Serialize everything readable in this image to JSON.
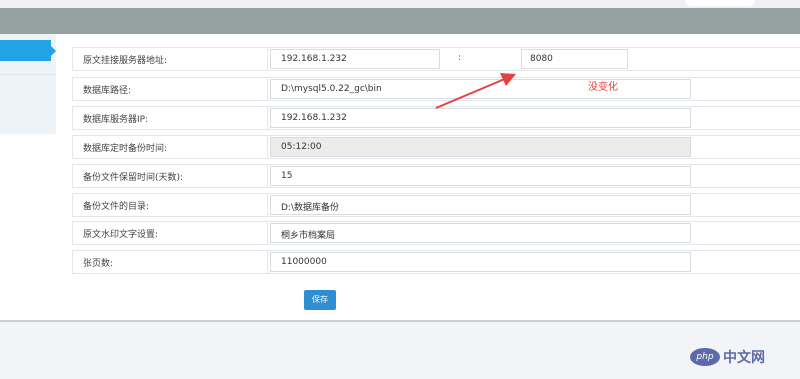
{
  "form": {
    "rows": [
      {
        "label": "原文挂接服务器地址:",
        "value": "192.168.1.232",
        "separator": ":",
        "port": "8080"
      },
      {
        "label": "数据库路径:",
        "value": "D:\\mysql5.0.22_gc\\bin"
      },
      {
        "label": "数据库服务器IP:",
        "value": "192.168.1.232"
      },
      {
        "label": "数据库定时备份时间:",
        "value": "05:12:00"
      },
      {
        "label": "备份文件保留时间(天数):",
        "value": "15"
      },
      {
        "label": "备份文件的目录:",
        "value": "D:\\数据库备份"
      },
      {
        "label": "原文水印文字设置:",
        "value": "桐乡市档案局"
      },
      {
        "label": "张页数:",
        "value": "11000000"
      }
    ],
    "save_label": "保存"
  },
  "annotation": {
    "text": "没变化",
    "color": "#e34242"
  },
  "watermark": {
    "badge": "php",
    "text": "中文网"
  },
  "colors": {
    "accent": "#22a3e6",
    "button": "#2d8fd2",
    "topbar": "#94a3a2"
  }
}
